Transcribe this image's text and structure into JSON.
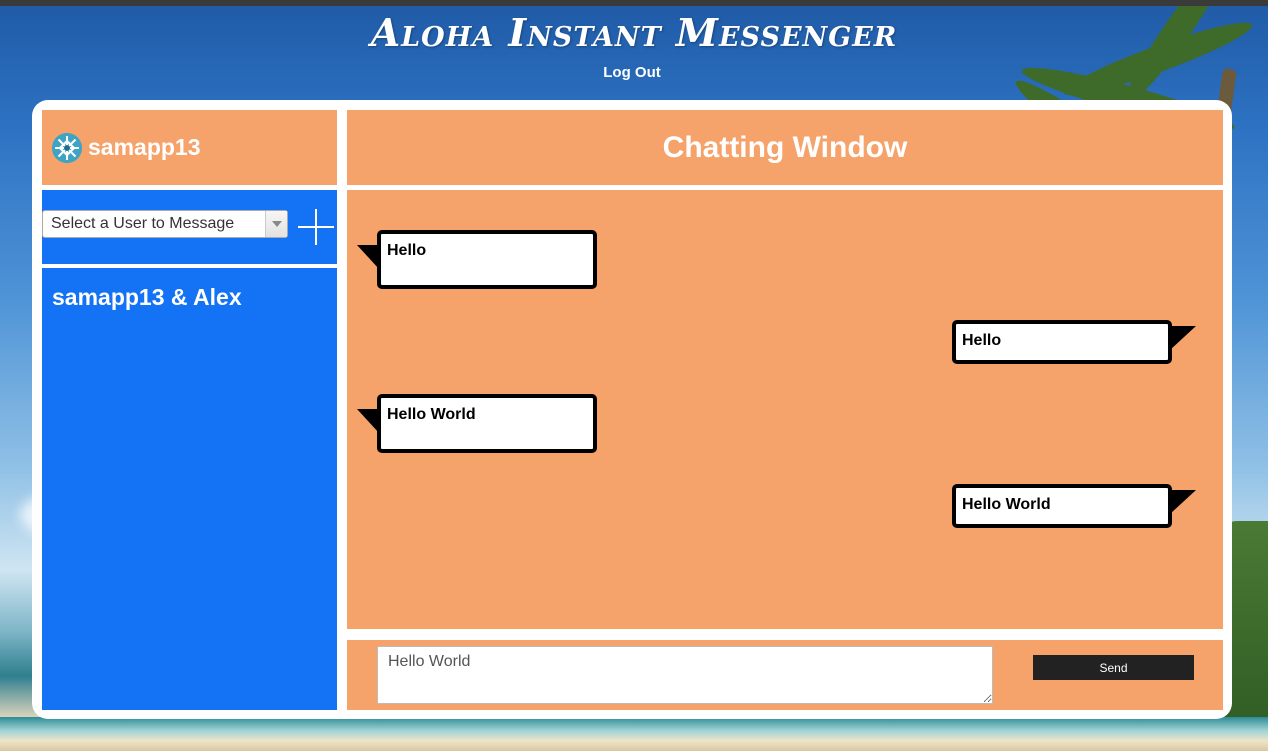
{
  "app": {
    "title": "Aloha Instant Messenger",
    "logout_label": "Log Out"
  },
  "sidebar": {
    "username": "samapp13",
    "avatar_icon": "snowflake-emblem-icon",
    "user_select": {
      "selected_label": "Select a User to Message"
    },
    "add_icon": "plus-icon",
    "conversations": [
      {
        "label": "samapp13 & Alex"
      }
    ]
  },
  "chat": {
    "title": "Chatting Window",
    "messages": [
      {
        "text": "Hello",
        "side": "left"
      },
      {
        "text": "Hello",
        "side": "right"
      },
      {
        "text": "Hello World",
        "side": "left"
      },
      {
        "text": "Hello World",
        "side": "right"
      }
    ],
    "composer": {
      "input_value": "Hello World",
      "send_label": "Send"
    }
  },
  "colors": {
    "panel_orange": "#f5a36a",
    "panel_blue": "#1472f5",
    "send_button": "#222222"
  }
}
